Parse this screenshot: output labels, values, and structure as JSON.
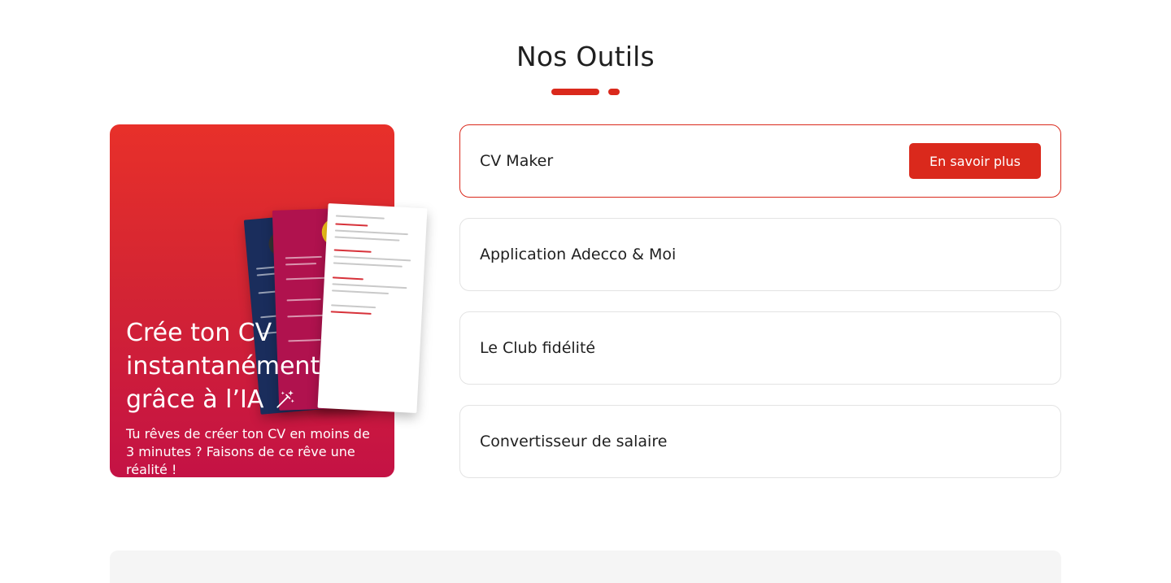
{
  "section": {
    "title": "Nos Outils"
  },
  "promo": {
    "title": "Crée ton CV instantanément grâce à l’IA",
    "description": "Tu rêves de créer ton CV en moins de 3 minutes ? Faisons de ce rêve une réalité !",
    "icon": "magic-wand-icon",
    "colors": {
      "gradient_top": "#e8302a",
      "gradient_bottom": "#c41245"
    }
  },
  "tools": [
    {
      "label": "CV Maker",
      "active": true,
      "button_label": "En savoir plus"
    },
    {
      "label": "Application Adecco & Moi",
      "active": false
    },
    {
      "label": "Le Club fidélité",
      "active": false
    },
    {
      "label": "Convertisseur de salaire",
      "active": false
    }
  ],
  "colors": {
    "accent": "#da291c",
    "border": "#e3e3e3"
  }
}
